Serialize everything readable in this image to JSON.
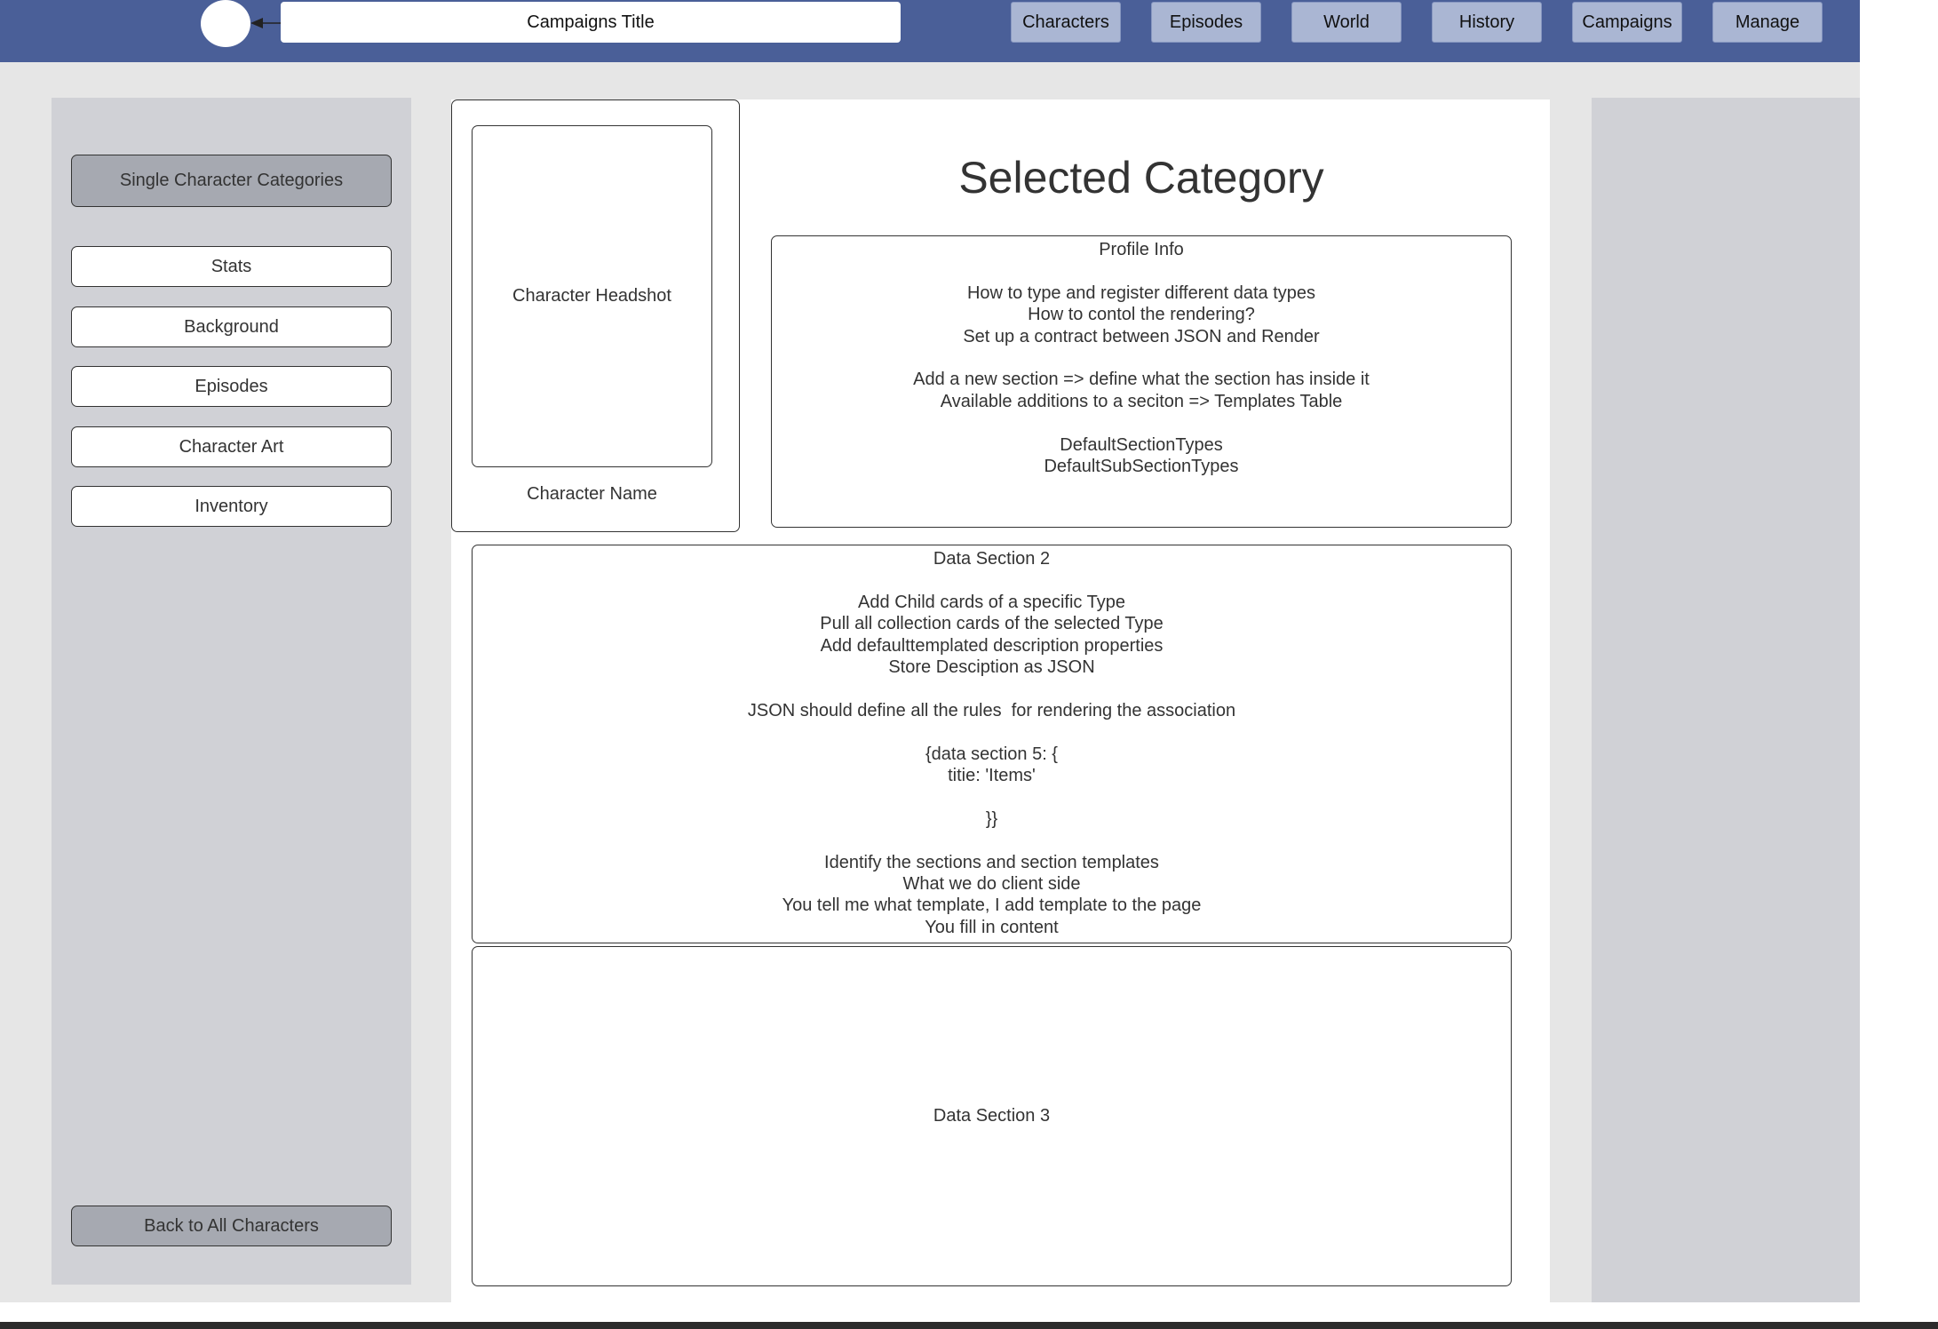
{
  "header": {
    "title": "Campaigns Title",
    "nav": [
      "Characters",
      "Episodes",
      "World",
      "History",
      "Campaigns",
      "Manage"
    ],
    "color": "#4a5f98",
    "nav_button_color": "#aab6d3"
  },
  "sidebar": {
    "heading": "Single Character Categories",
    "items": [
      "Stats",
      "Background",
      "Episodes",
      "Character Art",
      "Inventory"
    ],
    "back_label": "Back to All Characters"
  },
  "profile_card": {
    "headshot_label": "Character Headshot",
    "name_label": "Character Name"
  },
  "main": {
    "selected_category": "Selected Category"
  },
  "profile_info": {
    "lines": [
      "Profile Info",
      "",
      "How to type and register different data types",
      "How to contol the rendering?",
      "Set up a contract between JSON and Render",
      "",
      "Add a new section => define what the section has inside it",
      "Available additions to a seciton => Templates Table",
      "",
      "DefaultSectionTypes",
      "DefaultSubSectionTypes"
    ]
  },
  "data_section_2": {
    "lines": [
      "Data Section 2",
      "",
      "Add Child cards of a specific Type",
      "Pull all collection cards of the selected Type",
      "Add defaulttemplated description properties",
      "Store Desciption as JSON",
      "",
      "JSON should define all the rules  for rendering the association",
      "",
      "{data section 5: {",
      "titie: 'Items'",
      "",
      "}}",
      "",
      "Identify the sections and section templates",
      "What we do client side",
      "You tell me what template, I add template to the page",
      "You fill in content"
    ]
  },
  "data_section_3": {
    "label": "Data Section 3"
  }
}
